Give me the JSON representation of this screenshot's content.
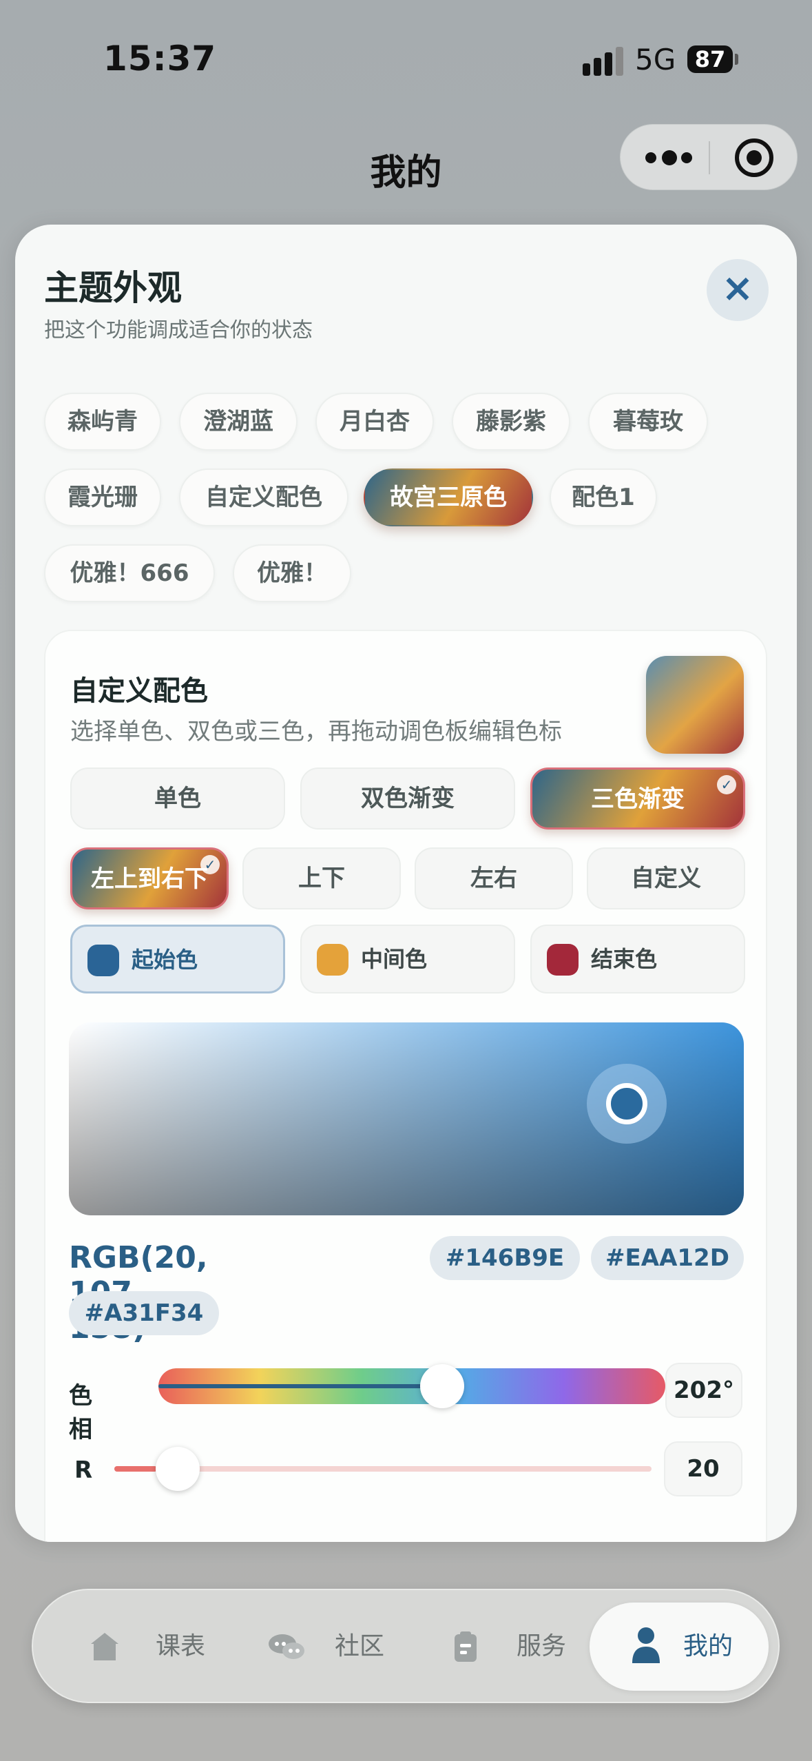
{
  "status_bar": {
    "time": "15:37",
    "network": "5G",
    "battery": "87"
  },
  "nav": {
    "title": "我的"
  },
  "sheet": {
    "title": "主题外观",
    "subtitle": "把这个功能调成适合你的状态",
    "themes": [
      "森屿青",
      "澄湖蓝",
      "月白杏",
      "藤影紫",
      "暮莓玫",
      "霞光珊",
      "自定义配色",
      "故宫三原色",
      "配色1",
      "优雅！666",
      "优雅！"
    ],
    "selected_theme": "故宫三原色"
  },
  "custom": {
    "title": "自定义配色",
    "subtitle": "选择单色、双色或三色，再拖动调色板编辑色标",
    "modes": [
      "单色",
      "双色渐变",
      "三色渐变"
    ],
    "selected_mode": "三色渐变",
    "directions": [
      "左上到右下",
      "上下",
      "左右",
      "自定义"
    ],
    "selected_direction": "左上到右下",
    "stops": [
      {
        "label": "起始色",
        "color": "#2a6496"
      },
      {
        "label": "中间色",
        "color": "#e4a23a"
      },
      {
        "label": "结束色",
        "color": "#a3283a"
      }
    ],
    "selected_stop": "起始色",
    "rgb_text": "RGB(20, 107, 158)",
    "hex_codes": [
      "#146B9E",
      "#EAA12D",
      "#A31F34"
    ],
    "hue_label": "色相",
    "hue_value": "202°",
    "hue_fraction": 0.56,
    "r_label": "R",
    "r_value": "20",
    "r_fraction": 0.08
  },
  "tabbar": {
    "items": [
      "课表",
      "社区",
      "服务",
      "我的"
    ],
    "active": "我的"
  }
}
